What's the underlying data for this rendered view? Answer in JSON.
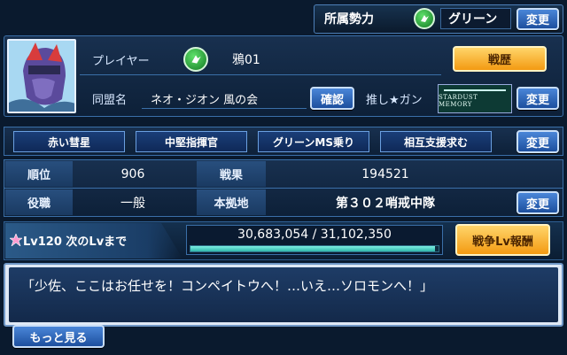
{
  "top_bar": {
    "affiliation_label": "所属勢力",
    "affiliation_value": "グリーン",
    "change_label": "変更"
  },
  "player": {
    "player_label": "プレイヤー",
    "name": "鴉01",
    "history_button": "戦歴",
    "alliance_label": "同盟名",
    "alliance_name": "ネオ・ジオン 風の会",
    "confirm_button": "確認",
    "favorite_label": "推し★ガン",
    "favorite_logo_text": "STARDUST MEMORY",
    "change_label": "変更"
  },
  "tags": {
    "items": [
      "赤い彗星",
      "中堅指揮官",
      "グリーンMS乗り",
      "相互支援求む"
    ],
    "change_label": "変更"
  },
  "stats": {
    "rank_label": "順位",
    "rank_value": "906",
    "result_label": "戦果",
    "result_value": "194521",
    "role_label": "役職",
    "role_value": "一般",
    "base_label": "本拠地",
    "base_value": "第３０２哨戒中隊",
    "change_label": "変更"
  },
  "level": {
    "level_text": "Lv120 次のLvまで",
    "exp_text": "30,683,054 / 31,102,350",
    "exp_fraction": 0.9865,
    "reward_button": "戦争Lv報酬"
  },
  "message": {
    "text": "「少佐、ここはお任せを！コンペイトウへ！…いえ…ソロモンへ！」"
  },
  "more_button": "もっと見る",
  "colors": {
    "accent_blue": "#1d4f9e",
    "accent_orange": "#f39a12",
    "faction_green": "#2fb544",
    "exp_bar": "#3fd0c4"
  }
}
